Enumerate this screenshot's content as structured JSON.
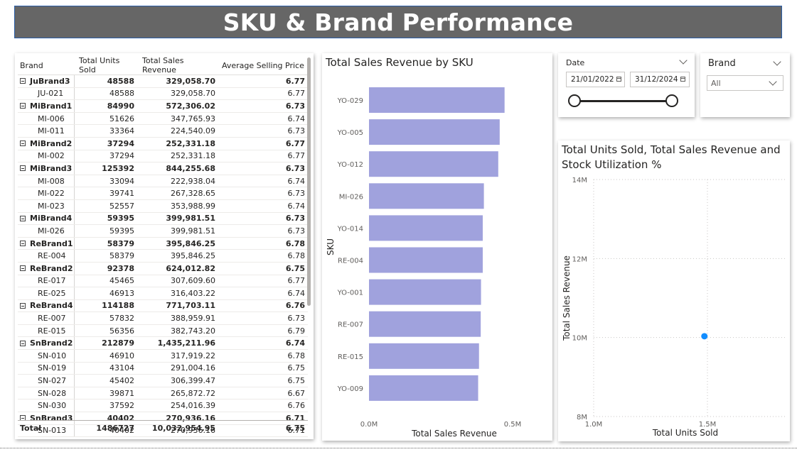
{
  "page": {
    "title": "SKU & Brand Performance"
  },
  "matrix": {
    "headers": {
      "brand": "Brand",
      "units": "Total Units Sold",
      "revenue": "Total Sales Revenue",
      "asp": "Average Selling Price"
    },
    "rows": [
      {
        "label": "JuBrand3",
        "units": "48588",
        "revenue": "329,058.70",
        "asp": "6.77",
        "level": "brand"
      },
      {
        "label": "JU-021",
        "units": "48588",
        "revenue": "329,058.70",
        "asp": "6.77",
        "level": "sku"
      },
      {
        "label": "MiBrand1",
        "units": "84990",
        "revenue": "572,306.02",
        "asp": "6.73",
        "level": "brand"
      },
      {
        "label": "MI-006",
        "units": "51626",
        "revenue": "347,765.93",
        "asp": "6.74",
        "level": "sku"
      },
      {
        "label": "MI-011",
        "units": "33364",
        "revenue": "224,540.09",
        "asp": "6.73",
        "level": "sku"
      },
      {
        "label": "MiBrand2",
        "units": "37294",
        "revenue": "252,331.18",
        "asp": "6.77",
        "level": "brand"
      },
      {
        "label": "MI-002",
        "units": "37294",
        "revenue": "252,331.18",
        "asp": "6.77",
        "level": "sku"
      },
      {
        "label": "MiBrand3",
        "units": "125392",
        "revenue": "844,255.68",
        "asp": "6.73",
        "level": "brand"
      },
      {
        "label": "MI-008",
        "units": "33094",
        "revenue": "222,938.04",
        "asp": "6.74",
        "level": "sku"
      },
      {
        "label": "MI-022",
        "units": "39741",
        "revenue": "267,328.65",
        "asp": "6.73",
        "level": "sku"
      },
      {
        "label": "MI-023",
        "units": "52557",
        "revenue": "353,988.99",
        "asp": "6.74",
        "level": "sku"
      },
      {
        "label": "MiBrand4",
        "units": "59395",
        "revenue": "399,981.51",
        "asp": "6.73",
        "level": "brand"
      },
      {
        "label": "MI-026",
        "units": "59395",
        "revenue": "399,981.51",
        "asp": "6.73",
        "level": "sku"
      },
      {
        "label": "ReBrand1",
        "units": "58379",
        "revenue": "395,846.25",
        "asp": "6.78",
        "level": "brand"
      },
      {
        "label": "RE-004",
        "units": "58379",
        "revenue": "395,846.25",
        "asp": "6.78",
        "level": "sku"
      },
      {
        "label": "ReBrand2",
        "units": "92378",
        "revenue": "624,012.82",
        "asp": "6.75",
        "level": "brand"
      },
      {
        "label": "RE-017",
        "units": "45465",
        "revenue": "307,609.60",
        "asp": "6.77",
        "level": "sku"
      },
      {
        "label": "RE-025",
        "units": "46913",
        "revenue": "316,403.22",
        "asp": "6.74",
        "level": "sku"
      },
      {
        "label": "ReBrand4",
        "units": "114188",
        "revenue": "771,703.11",
        "asp": "6.76",
        "level": "brand"
      },
      {
        "label": "RE-007",
        "units": "57832",
        "revenue": "388,959.91",
        "asp": "6.73",
        "level": "sku"
      },
      {
        "label": "RE-015",
        "units": "56356",
        "revenue": "382,743.20",
        "asp": "6.79",
        "level": "sku"
      },
      {
        "label": "SnBrand2",
        "units": "212879",
        "revenue": "1,435,211.96",
        "asp": "6.74",
        "level": "brand"
      },
      {
        "label": "SN-010",
        "units": "46910",
        "revenue": "317,919.22",
        "asp": "6.78",
        "level": "sku"
      },
      {
        "label": "SN-019",
        "units": "43104",
        "revenue": "291,004.16",
        "asp": "6.75",
        "level": "sku"
      },
      {
        "label": "SN-027",
        "units": "45402",
        "revenue": "306,399.47",
        "asp": "6.75",
        "level": "sku"
      },
      {
        "label": "SN-028",
        "units": "39871",
        "revenue": "265,872.72",
        "asp": "6.67",
        "level": "sku"
      },
      {
        "label": "SN-030",
        "units": "37592",
        "revenue": "254,016.39",
        "asp": "6.76",
        "level": "sku"
      },
      {
        "label": "SnBrand3",
        "units": "40402",
        "revenue": "270,936.16",
        "asp": "6.71",
        "level": "brand"
      },
      {
        "label": "SN-013",
        "units": "40402",
        "revenue": "270,936.16",
        "asp": "6.71",
        "level": "sku"
      }
    ],
    "total": {
      "label": "Total",
      "units": "1486727",
      "revenue": "10,032,954.95",
      "asp": "6.75"
    }
  },
  "date_slicer": {
    "label": "Date",
    "start": "21/01/2022",
    "end": "31/12/2024"
  },
  "brand_slicer": {
    "label": "Brand",
    "selected": "All"
  },
  "colors": {
    "bar": "#a0a2dd",
    "point": "#118dff",
    "title_bg": "#666666",
    "title_border": "#2b5ea7"
  },
  "chart_data": [
    {
      "type": "bar",
      "orientation": "horizontal",
      "title": "Total Sales Revenue by SKU",
      "xlabel": "Total Sales Revenue",
      "ylabel": "SKU",
      "categories": [
        "YO-029",
        "YO-005",
        "YO-012",
        "MI-026",
        "YO-014",
        "RE-004",
        "YO-001",
        "RE-007",
        "RE-015",
        "YO-009"
      ],
      "values": [
        472000,
        455000,
        450000,
        400000,
        396000,
        396000,
        390000,
        389000,
        383000,
        380000
      ],
      "xlim": [
        0,
        500000
      ],
      "xticks": [
        "0.0M",
        "0.5M"
      ]
    },
    {
      "type": "scatter",
      "title": "Total Units Sold, Total Sales Revenue and Stock Utilization %",
      "title_lines": [
        "Total Units Sold, Total Sales Revenue and",
        "Stock Utilization %"
      ],
      "xlabel": "Total Units Sold",
      "ylabel": "Total Sales Revenue",
      "points": [
        {
          "x": 1486727,
          "y": 10032954.95
        }
      ],
      "xlim": [
        1000000,
        2000000
      ],
      "ylim": [
        8000000,
        14000000
      ],
      "xticks": [
        {
          "v": 1000000,
          "label": "1.0M"
        },
        {
          "v": 1500000,
          "label": "1.5M"
        }
      ],
      "yticks": [
        {
          "v": 8000000,
          "label": "8M"
        },
        {
          "v": 10000000,
          "label": "10M"
        },
        {
          "v": 12000000,
          "label": "12M"
        },
        {
          "v": 14000000,
          "label": "14M"
        }
      ]
    }
  ]
}
